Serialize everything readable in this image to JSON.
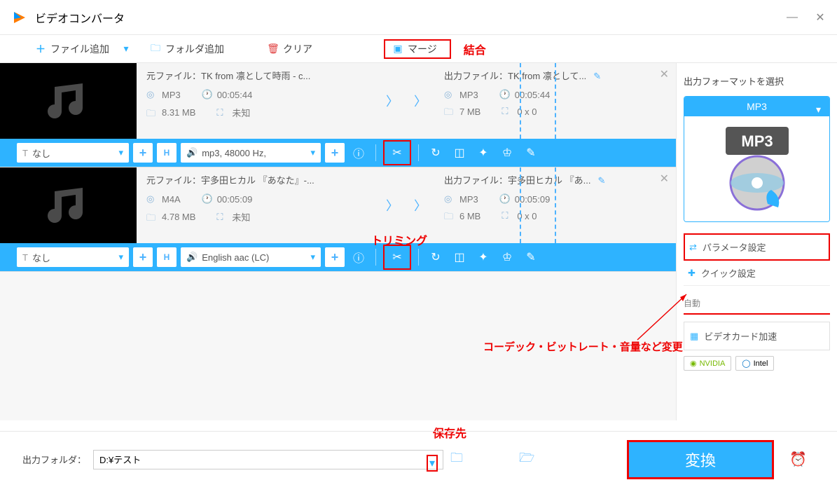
{
  "app": {
    "title": "ビデオコンバータ"
  },
  "toolbar": {
    "addFile": "ファイル追加",
    "addFolder": "フォルダ追加",
    "clear": "クリア",
    "merge": "マージ"
  },
  "annotations": {
    "merge": "結合",
    "trim": "トリミング",
    "params": "コーデック・ビットレート・音量など変更",
    "saveTo": "保存先"
  },
  "files": [
    {
      "srcLabel": "元ファイル：",
      "srcName": "TK from 凛として時雨 - c...",
      "srcFormat": "MP3",
      "srcDur": "00:05:44",
      "srcSize": "8.31 MB",
      "srcRes": "未知",
      "outLabel": "出力ファイル：",
      "outName": "TK from 凛として...",
      "outFormat": "MP3",
      "outDur": "00:05:44",
      "outSize": "7 MB",
      "outRes": "0 x 0",
      "subTrack": "なし",
      "audioTrack": "mp3, 48000 Hz,"
    },
    {
      "srcLabel": "元ファイル：",
      "srcName": "宇多田ヒカル 『あなた』-...",
      "srcFormat": "M4A",
      "srcDur": "00:05:09",
      "srcSize": "4.78 MB",
      "srcRes": "未知",
      "outLabel": "出力ファイル：",
      "outName": "宇多田ヒカル 『あ...",
      "outFormat": "MP3",
      "outDur": "00:05:09",
      "outSize": "6 MB",
      "outRes": "0 x 0",
      "subTrack": "なし",
      "audioTrack": "English aac (LC)"
    }
  ],
  "side": {
    "title": "出力フォーマットを選択",
    "formatLabel": "MP3",
    "formatBig": "MP3",
    "params": "パラメータ設定",
    "quick": "クイック設定",
    "auto": "自動",
    "hw": "ビデオカード加速",
    "nvidia": "NVIDIA",
    "intel": "Intel"
  },
  "footer": {
    "label": "出力フォルダ：",
    "path": "D:¥テスト",
    "convert": "変換"
  }
}
